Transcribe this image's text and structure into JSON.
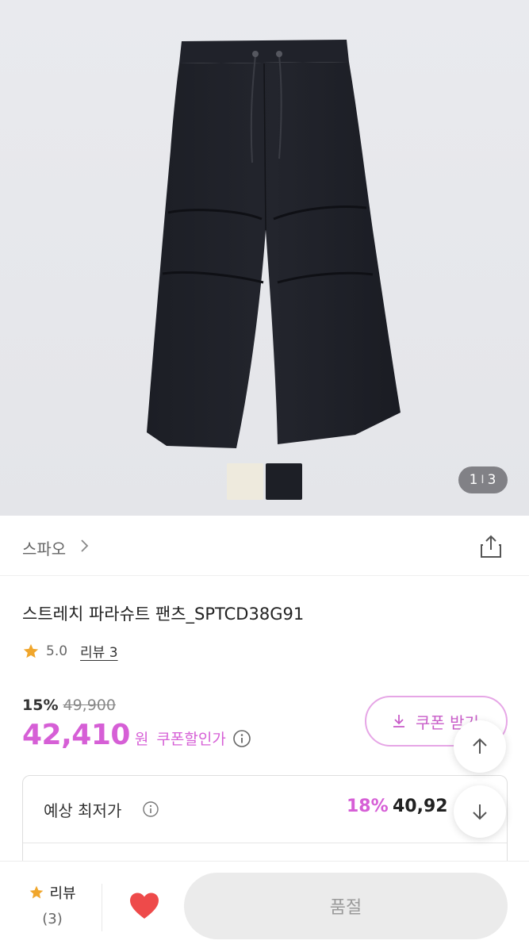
{
  "gallery": {
    "current": "1",
    "total": "3",
    "separator": "I",
    "swatches": [
      {
        "name": "cream",
        "color": "#eeeadd"
      },
      {
        "name": "black",
        "color": "#1d1f26"
      }
    ]
  },
  "brand": {
    "name": "스파오",
    "icons": {
      "chevron": "chevron-right-icon",
      "share": "share-icon"
    }
  },
  "product": {
    "title": "스트레치 파라슈트 팬츠_SPTCD38G91",
    "rating": "5.0",
    "review_link": "리뷰 3"
  },
  "pricing": {
    "discount_rate": "15%",
    "original_price": "49,900",
    "price": "42,410",
    "currency": "원",
    "coupon_price_label": "쿠폰할인가",
    "coupon_button": "쿠폰 받기",
    "accent_color": "#d65fd6"
  },
  "lowest": {
    "label": "예상 최저가",
    "rate": "18%",
    "price": "40,92"
  },
  "bottom_bar": {
    "review_label": "리뷰",
    "review_count": "(3)",
    "soldout_label": "품절"
  }
}
